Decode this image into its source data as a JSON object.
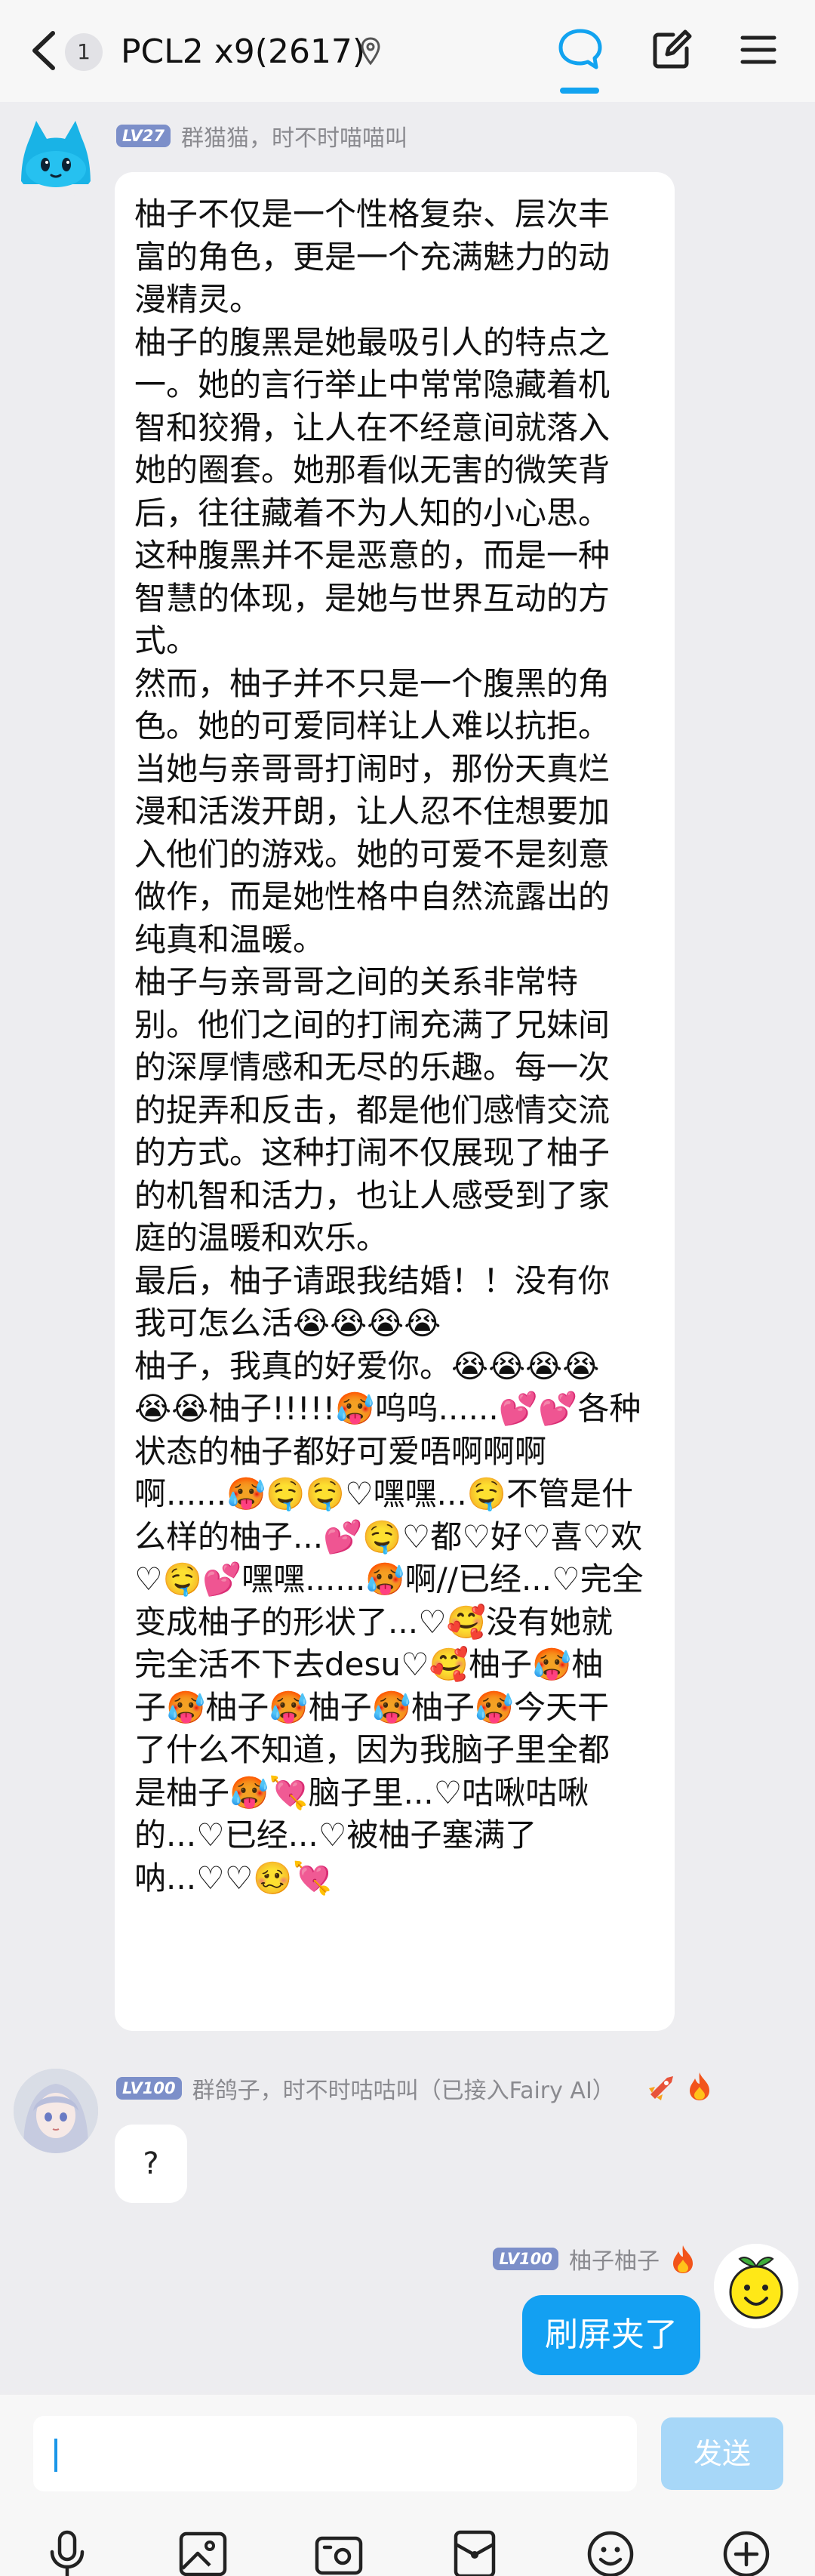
{
  "header": {
    "unread_count": "1",
    "title": "PCL2 x9(2617)",
    "accent_color": "#12a3f0",
    "icons": [
      "back-icon",
      "pin-icon",
      "chat-icon",
      "edit-icon",
      "menu-icon"
    ]
  },
  "messages": [
    {
      "level": "LV27",
      "name": "群猫猫，时不时喵喵叫",
      "lines": [
        "柚子不仅是一个性格复杂、层次丰",
        "富的角色，更是一个充满魅力的动",
        "漫精灵。",
        "柚子的腹黑是她最吸引人的特点之",
        "一。她的言行举止中常常隐藏着机",
        "智和狡猾，让人在不经意间就落入",
        "她的圈套。她那看似无害的微笑背",
        "后，往往藏着不为人知的小心思。",
        "这种腹黑并不是恶意的，而是一种",
        "智慧的体现，是她与世界互动的方",
        "式。",
        "然而，柚子并不只是一个腹黑的角",
        "色。她的可爱同样让人难以抗拒。",
        "当她与亲哥哥打闹时，那份天真烂",
        "漫和活泼开朗，让人忍不住想要加",
        "入他们的游戏。她的可爱不是刻意",
        "做作，而是她性格中自然流露出的",
        "纯真和温暖。",
        "柚子与亲哥哥之间的关系非常特",
        "别。他们之间的打闹充满了兄妹间",
        "的深厚情感和无尽的乐趣。每一次",
        "的捉弄和反击，都是他们感情交流",
        "的方式。这种打闹不仅展现了柚子",
        "的机智和活力，也让人感受到了家",
        "庭的温暖和欢乐。",
        "最后，柚子请跟我结婚！！没有你",
        "我可怎么活😭😭😭😭",
        "柚子，我真的好爱你。😭😭😭😭",
        "😭😭柚子!!!!!🥵呜呜......💕💕各种",
        "状态的柚子都好可爱唔啊啊啊",
        "啊......🥵🤤🤤♡嘿嘿...🤤不管是什",
        "么样的柚子...💕🤤♡都♡好♡喜♡欢",
        "♡🤤💕嘿嘿......🥵啊//已经...♡完全",
        "变成柚子的形状了...♡🥰没有她就",
        "完全活不下去desu♡🥰柚子🥵柚",
        "子🥵柚子🥵柚子🥵柚子🥵今天干",
        "了什么不知道，因为我脑子里全都",
        "是柚子🥵💘脑子里...♡咕啾咕啾",
        "的...♡已经...♡被柚子塞满了",
        "呐...♡♡🥴💘"
      ]
    },
    {
      "level": "LV100",
      "name": "群鸽子，时不时咕咕叫（已接入Fairy AI）",
      "text": "?"
    },
    {
      "level": "LV100",
      "name": "柚子柚子",
      "text": "刷屏夹了"
    }
  ],
  "input": {
    "value": "",
    "send_label": "发送"
  },
  "toolbar": {
    "icons": [
      "microphone-icon",
      "image-icon",
      "camera-icon",
      "red-packet-icon",
      "emoji-icon",
      "plus-icon"
    ]
  }
}
